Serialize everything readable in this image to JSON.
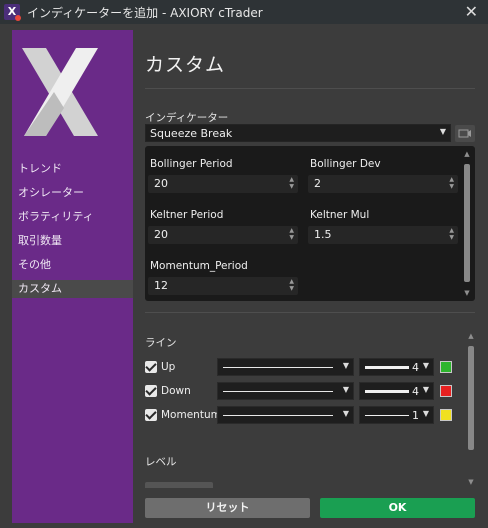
{
  "window": {
    "title": "インディケーターを追加 - AXIORY cTrader",
    "close": "✕"
  },
  "sidebar": {
    "items": [
      {
        "label": "トレンド",
        "active": false
      },
      {
        "label": "オシレーター",
        "active": false
      },
      {
        "label": "ボラティリティ",
        "active": false
      },
      {
        "label": "取引数量",
        "active": false
      },
      {
        "label": "その他",
        "active": false
      },
      {
        "label": "カスタム",
        "active": true
      }
    ]
  },
  "main": {
    "title": "カスタム",
    "indicator_label": "インディケーター",
    "indicator_value": "Squeeze Break",
    "params": [
      {
        "label": "Bollinger Period",
        "value": "20"
      },
      {
        "label": "Bollinger Dev",
        "value": "2"
      },
      {
        "label": "Keltner Period",
        "value": "20"
      },
      {
        "label": "Keltner Mul",
        "value": "1.5"
      },
      {
        "label": "Momentum_Period",
        "value": "12"
      }
    ],
    "lines_label": "ライン",
    "lines": [
      {
        "label": "Up",
        "checked": true,
        "width": "4",
        "color": "#2db52d"
      },
      {
        "label": "Down",
        "checked": true,
        "width": "4",
        "color": "#e82020"
      },
      {
        "label": "Momentum",
        "checked": true,
        "width": "1",
        "color": "#f0e020"
      }
    ],
    "levels_label": "レベル"
  },
  "buttons": {
    "reset": "リセット",
    "ok": "OK"
  },
  "icons": {
    "app": "cTrader-app-icon",
    "camera": "camera-icon",
    "dropdown": "chevron-down-icon"
  },
  "colors": {
    "sidebar": "#6a2a88",
    "ok": "#1a9f52",
    "panel": "#1a1a1a"
  }
}
